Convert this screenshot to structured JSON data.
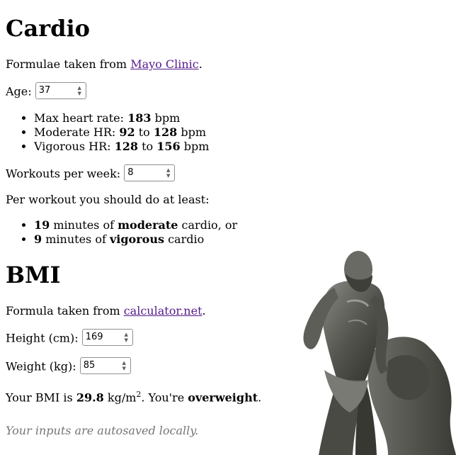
{
  "cardio": {
    "heading": "Cardio",
    "source_prefix": "Formulae taken from ",
    "source_link": "Mayo Clinic",
    "source_suffix": ".",
    "age_label": "Age: ",
    "age_value": "37",
    "max_hr_label": "Max heart rate: ",
    "max_hr_value": "183",
    "bpm": "bpm",
    "moderate_label": "Moderate HR: ",
    "moderate_low": "92",
    "to": "to",
    "moderate_high": "128",
    "vigorous_label": "Vigorous HR: ",
    "vigorous_low": "128",
    "vigorous_high": "156",
    "workouts_label": "Workouts per week: ",
    "workouts_value": "8",
    "per_workout": "Per workout you should do at least:",
    "moderate_minutes": "19",
    "minutes_of": "minutes of",
    "moderate_word": "moderate",
    "moderate_tail": "cardio, or",
    "vigorous_minutes": "9",
    "vigorous_word": "vigorous",
    "vigorous_tail": "cardio"
  },
  "bmi": {
    "heading": "BMI",
    "source_prefix": "Formula taken from ",
    "source_link": "calculator.net",
    "source_suffix": ".",
    "height_label": "Height (cm): ",
    "height_value": "169",
    "weight_label": "Weight (kg): ",
    "weight_value": "85",
    "result_prefix": "Your BMI is ",
    "bmi_value": "29.8",
    "unit": "kg/m",
    "unit_exp": "2",
    "you_are": ". You're ",
    "category": "overweight",
    "period": "."
  },
  "footer_note": "Your inputs are autosaved locally.",
  "icons": {
    "spinner": "up-down-arrows",
    "decoration": "hercules-statue-image"
  }
}
